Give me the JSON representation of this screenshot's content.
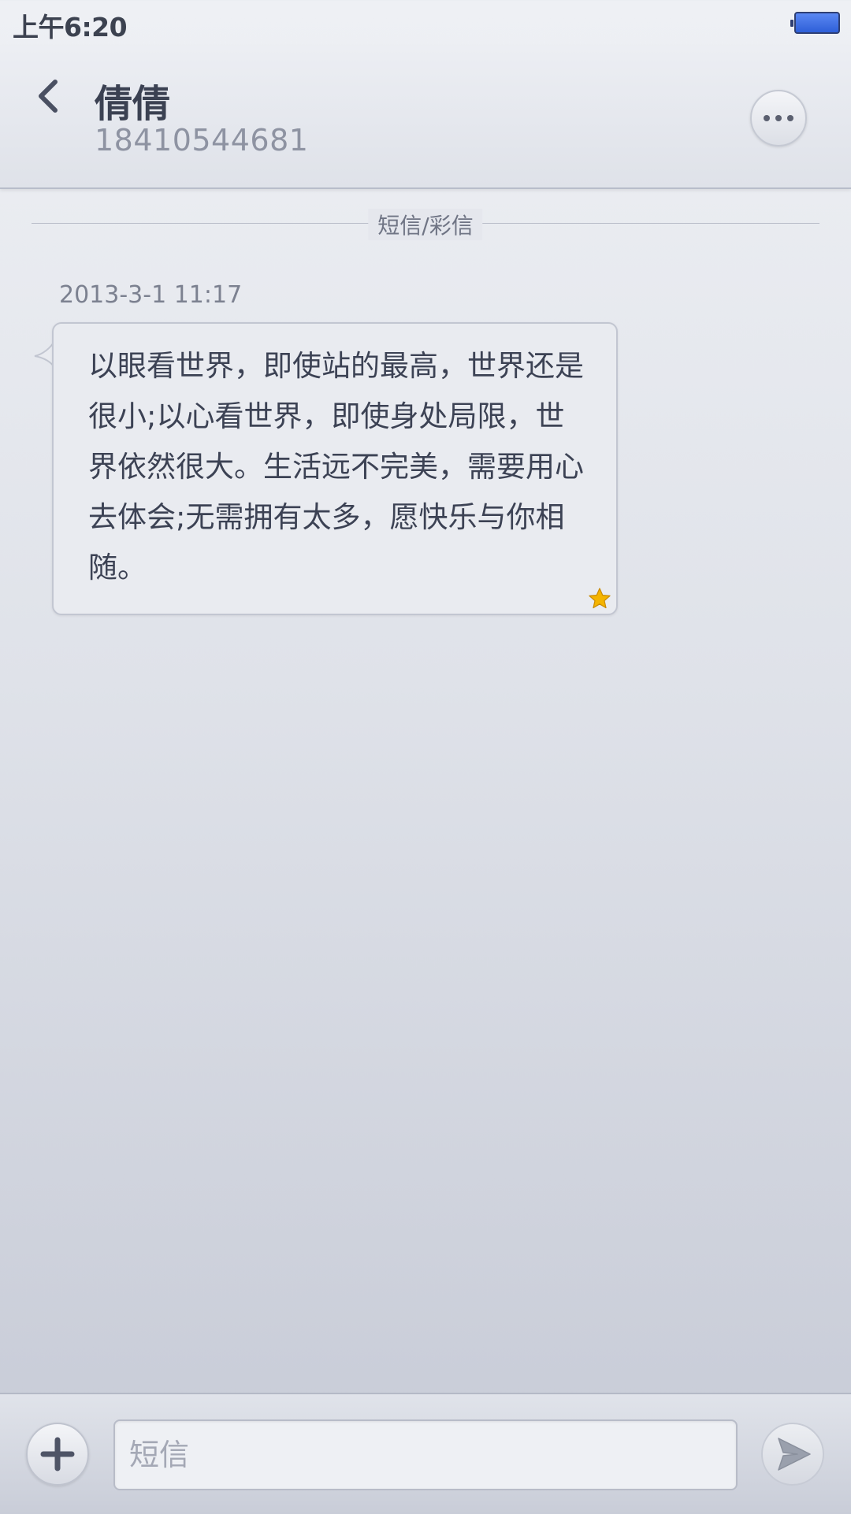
{
  "status_bar": {
    "time": "上午6:20",
    "battery_icon": "battery-full-icon"
  },
  "header": {
    "back_icon": "chevron-left-icon",
    "contact_name": "倩倩",
    "contact_number": "18410544681",
    "more_icon": "ellipsis-icon"
  },
  "conversation": {
    "section_label": "短信/彩信",
    "messages": [
      {
        "timestamp": "2013-3-1 11:17",
        "text": "以眼看世界，即使站的最高，世界还是很小;以心看世界，即使身处局限，世界依然很大。生活远不完美，需要用心去体会;无需拥有太多，愿快乐与你相随。",
        "starred": true,
        "star_icon": "star-icon"
      }
    ]
  },
  "composer": {
    "add_icon": "plus-icon",
    "placeholder": "短信",
    "value": "",
    "send_icon": "send-icon"
  },
  "colors": {
    "text_primary": "#3c4254",
    "text_secondary": "#8e93a2",
    "battery": "#3b6ae0",
    "star": "#f4b400"
  }
}
